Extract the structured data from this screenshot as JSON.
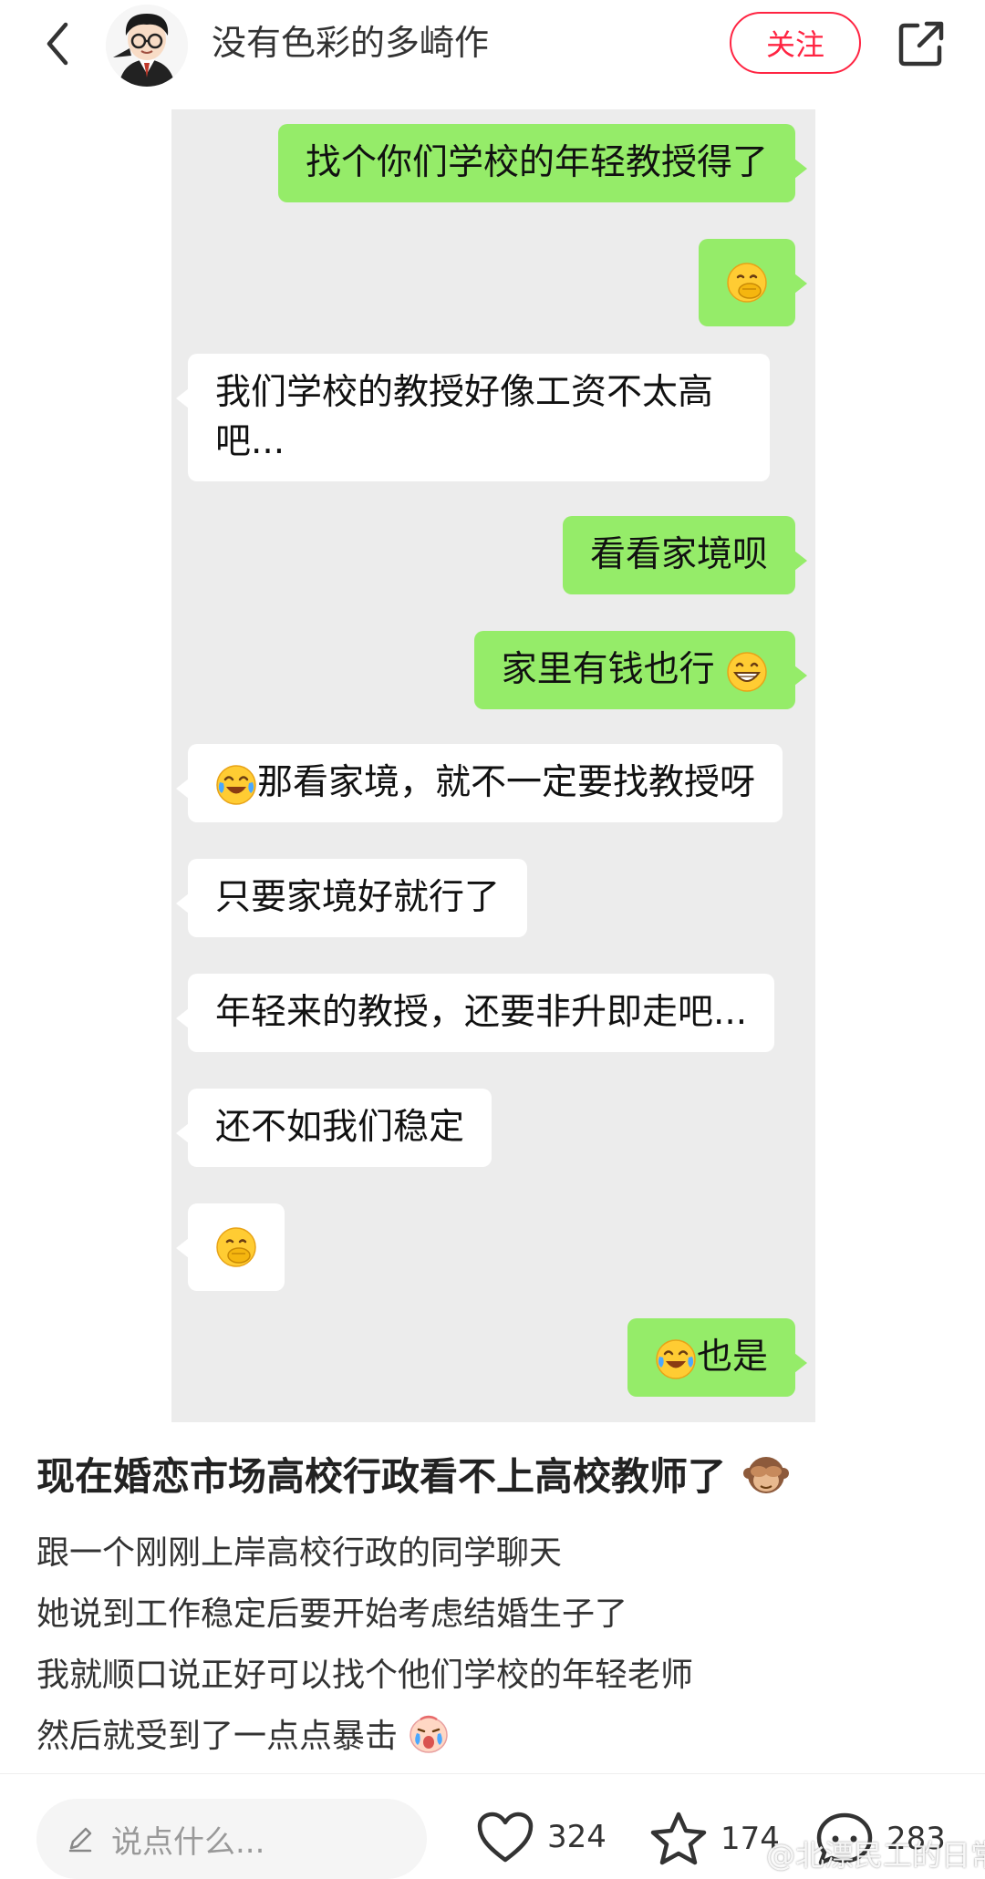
{
  "header": {
    "author_name": "没有色彩的多崎作",
    "follow_label": "关注"
  },
  "chat": {
    "messages": [
      {
        "side": "me",
        "text": "找个你们学校的年轻教授得了"
      },
      {
        "side": "me",
        "emoji": "hand-over-mouth-emoji"
      },
      {
        "side": "them",
        "line1": "我们学校的教授好像工资不太高",
        "line2": "吧..."
      },
      {
        "side": "me",
        "text": "看看家境呗"
      },
      {
        "side": "me",
        "text": "家里有钱也行",
        "emoji": "grinning-emoji"
      },
      {
        "side": "them",
        "emoji": "tears-of-joy-emoji",
        "text": "那看家境，就不一定要找教授呀"
      },
      {
        "side": "them",
        "text": "只要家境好就行了"
      },
      {
        "side": "them",
        "text": "年轻来的教授，还要非升即走吧..."
      },
      {
        "side": "them",
        "text": "还不如我们稳定"
      },
      {
        "side": "them",
        "emoji": "hand-over-mouth-emoji"
      },
      {
        "side": "me",
        "emoji": "tears-of-joy-emoji",
        "text": "也是"
      }
    ]
  },
  "post": {
    "title": "现在婚恋市场高校行政看不上高校教师了",
    "title_emoji": "see-no-evil-monkey-emoji",
    "lines": [
      "跟一个刚刚上岸高校行政的同学聊天",
      "她说到工作稳定后要开始考虑结婚生子了",
      "我就顺口说正好可以找个他们学校的年轻老师",
      "然后就受到了一点点暴击"
    ],
    "last_line_emoji": "crying-face-emoji"
  },
  "bottom": {
    "comment_placeholder": "说点什么...",
    "likes": "324",
    "favorites": "174",
    "comments": "283"
  },
  "watermark": "@北漂民工的日常",
  "colors": {
    "accent": "#ff2442",
    "my_bubble": "#95ec69",
    "their_bubble": "#ffffff",
    "chat_background": "#ececec"
  }
}
